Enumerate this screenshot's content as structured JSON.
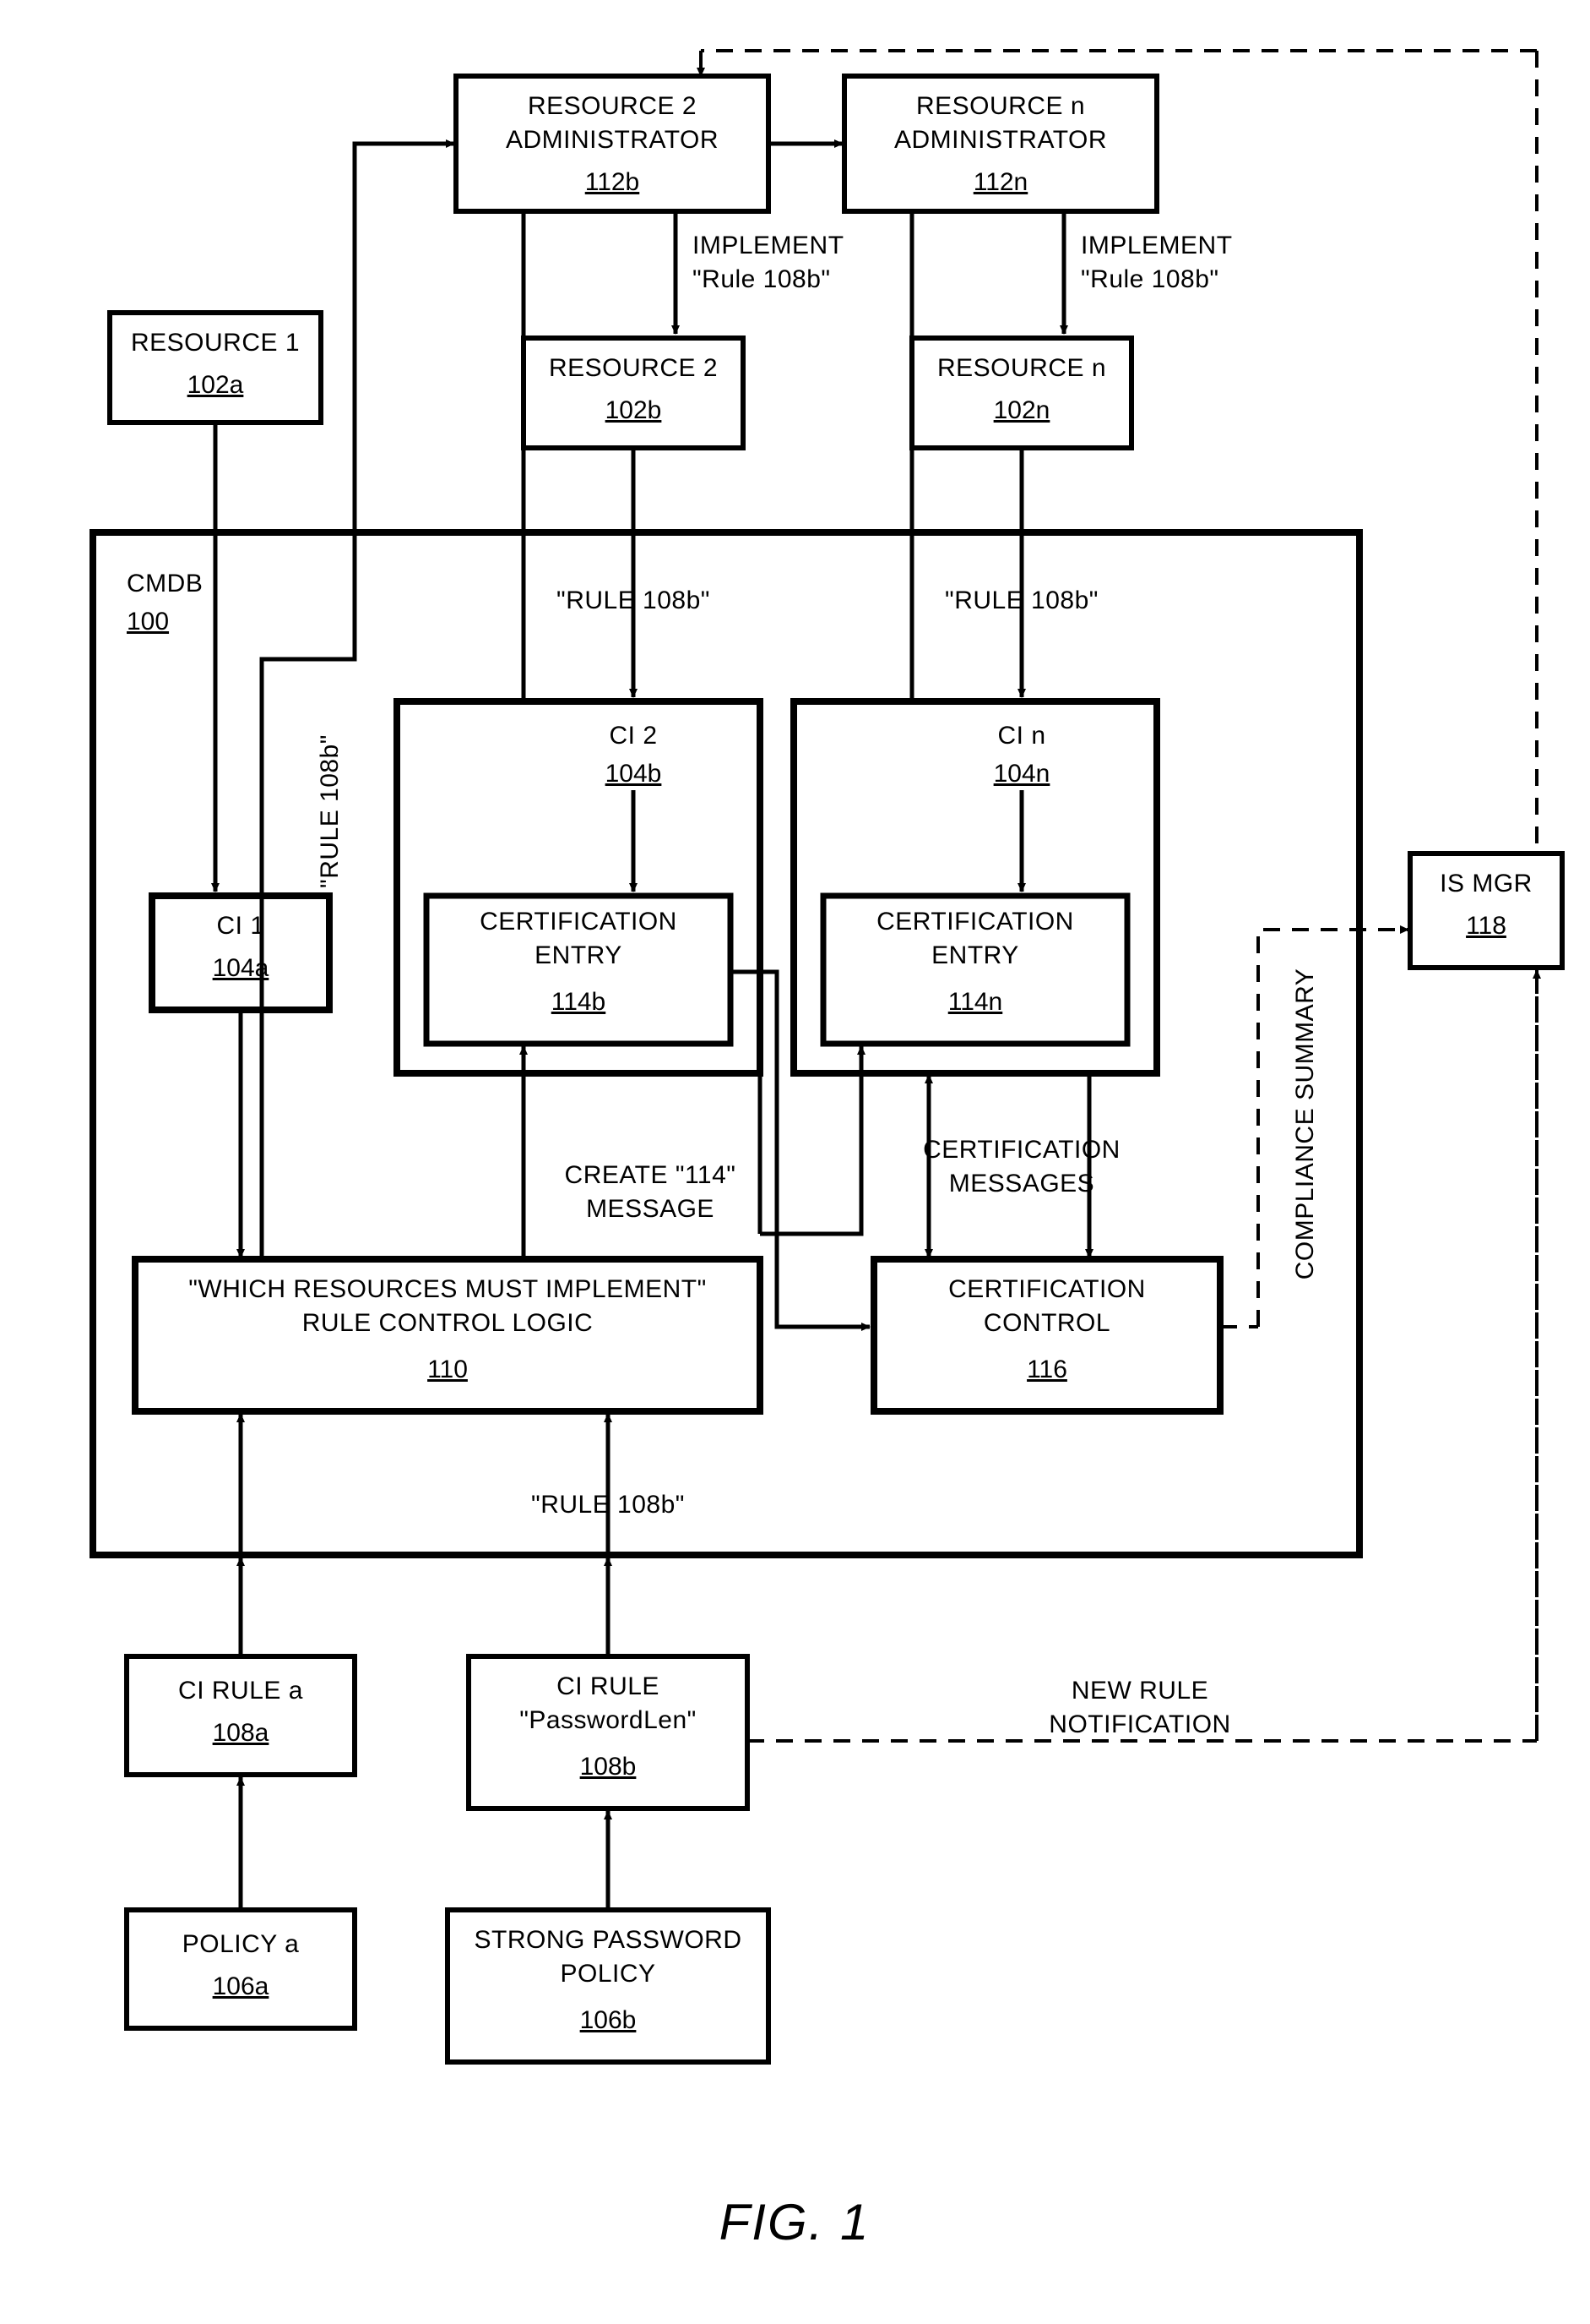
{
  "figure_label": "FIG. 1",
  "cmdb": {
    "label": "CMDB",
    "ref": "100"
  },
  "resource1": {
    "label": "RESOURCE 1",
    "ref": "102a"
  },
  "resource2_admin": {
    "l1": "RESOURCE 2",
    "l2": "ADMINISTRATOR",
    "ref": "112b"
  },
  "resource_n_admin": {
    "l1": "RESOURCE n",
    "l2": "ADMINISTRATOR",
    "ref": "112n"
  },
  "resource2": {
    "label": "RESOURCE 2",
    "ref": "102b"
  },
  "resource_n": {
    "label": "RESOURCE n",
    "ref": "102n"
  },
  "implement_b": {
    "l1": "IMPLEMENT",
    "l2": "\"Rule 108b\""
  },
  "implement_n": {
    "l1": "IMPLEMENT",
    "l2": "\"Rule 108b\""
  },
  "rule108b_vert": "\"RULE 108b\"",
  "rule108b_2": "\"RULE 108b\"",
  "rule108b_n": "\"RULE 108b\"",
  "rule108b_bottom": "\"RULE 108b\"",
  "ci1": {
    "label": "CI 1",
    "ref": "104a"
  },
  "ci2": {
    "label": "CI 2",
    "ref": "104b"
  },
  "cin": {
    "label": "CI n",
    "ref": "104n"
  },
  "cert_entry_b": {
    "l1": "CERTIFICATION",
    "l2": "ENTRY",
    "ref": "114b"
  },
  "cert_entry_n": {
    "l1": "CERTIFICATION",
    "l2": "ENTRY",
    "ref": "114n"
  },
  "ismgr": {
    "label": "IS MGR",
    "ref": "118"
  },
  "create114": {
    "l1": "CREATE \"114\"",
    "l2": "MESSAGE"
  },
  "cert_msgs": {
    "l1": "CERTIFICATION",
    "l2": "MESSAGES"
  },
  "compliance": "COMPLIANCE SUMMARY",
  "rule_logic": {
    "l1": "\"WHICH RESOURCES MUST IMPLEMENT\"",
    "l2": "RULE CONTROL LOGIC",
    "ref": "110"
  },
  "cert_ctrl": {
    "l1": "CERTIFICATION",
    "l2": "CONTROL",
    "ref": "116"
  },
  "ci_rule_a": {
    "label": "CI RULE a",
    "ref": "108a"
  },
  "ci_rule_b": {
    "l1": "CI RULE",
    "l2": "\"PasswordLen\"",
    "ref": "108b"
  },
  "new_rule": {
    "l1": "NEW RULE",
    "l2": "NOTIFICATION"
  },
  "policy_a": {
    "label": "POLICY a",
    "ref": "106a"
  },
  "policy_b": {
    "l1": "STRONG PASSWORD",
    "l2": "POLICY",
    "ref": "106b"
  }
}
